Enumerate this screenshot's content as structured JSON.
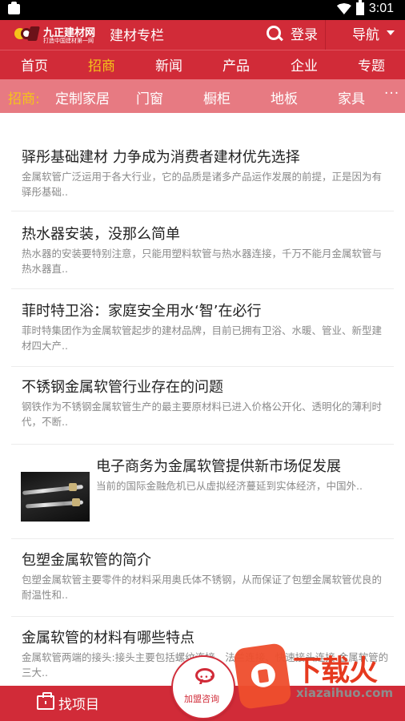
{
  "status_bar": {
    "time": "3:01",
    "icons": [
      "notification-icon",
      "wifi-icon",
      "battery-icon"
    ]
  },
  "header": {
    "logo_title": "九正建材网",
    "logo_subtitle": "打造中国建材第一网",
    "page_title": "建材专栏",
    "login_label": "登录",
    "nav_label": "导航"
  },
  "tabs": [
    "首页",
    "招商",
    "新闻",
    "产品",
    "企业",
    "专题"
  ],
  "active_tab": "招商",
  "subnav": {
    "lead": "招商:",
    "items": [
      "定制家居",
      "门窗",
      "橱柜",
      "地板",
      "家具"
    ],
    "more": "···"
  },
  "news": [
    {
      "title": "驿彤基础建材 力争成为消费者建材优先选择",
      "desc": "金属软管广泛运用于各大行业，它的品质是诸多产品运作发展的前提，正是因为有驿彤基础.."
    },
    {
      "title": "热水器安装，没那么简单",
      "desc": "热水器的安装要特别注意，只能用塑料软管与热水器连接，千万不能月金属软管与热水器直.."
    },
    {
      "title": "菲时特卫浴：家庭安全用水‘智’在必行",
      "desc": "菲时特集团作为金属软管起步的建材品牌，目前已拥有卫浴、水暖、管业、新型建材四大产.."
    },
    {
      "title": "不锈钢金属软管行业存在的问题",
      "desc": "钢铁作为不锈钢金属软管生产的最主要原材料已进入价格公开化、透明化的薄利时代，不断.."
    },
    {
      "title": "电子商务为金属软管提供新市场促发展",
      "desc": "当前的国际金融危机已从虚拟经济蔓延到实体经济，中国外..",
      "has_image": true
    },
    {
      "title": "包塑金属软管的简介",
      "desc": "包塑金属软管主要零件的材料采用奥氏体不锈钢，从而保证了包塑金属软管优良的耐温性和.."
    },
    {
      "title": "金属软管的材料有哪些特点",
      "desc": "金属软管两端的接头:接头主要包括螺纹连接、法兰连接、快速接头连接.金属软管的三大.."
    }
  ],
  "bottom_bar": {
    "find_label": "找项目"
  },
  "consult": {
    "label": "加盟咨询"
  },
  "watermark": {
    "text": "下载火",
    "url": "xiazaihuo.com"
  },
  "colors": {
    "brand_red": "#d12b38",
    "subnav_pink": "#e77a82",
    "accent_yellow": "#f4c419"
  }
}
